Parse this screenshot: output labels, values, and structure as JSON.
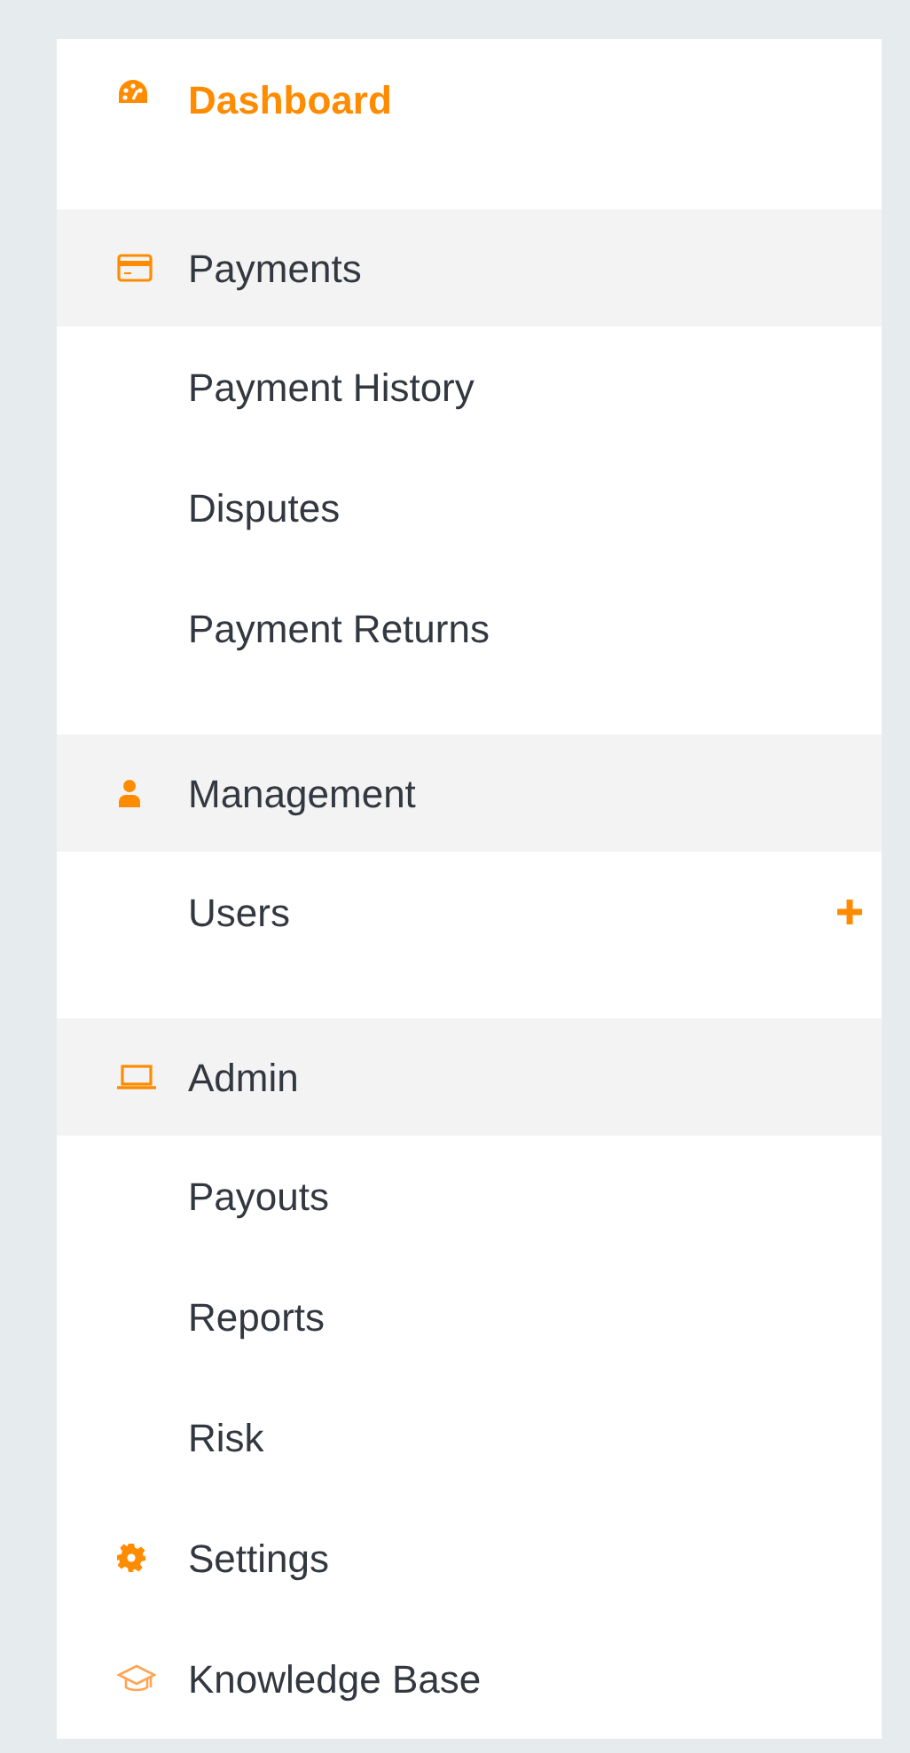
{
  "menu": [
    {
      "kind": "link",
      "label": "Dashboard",
      "selected": true
    },
    {
      "kind": "section",
      "label": "Payments",
      "selected": false,
      "children": [
        {
          "kind": "sub",
          "label": "Payment History",
          "selected": false
        },
        {
          "kind": "sub",
          "label": "Disputes",
          "selected": false
        },
        {
          "kind": "sub",
          "label": "Payment Returns",
          "selected": false
        }
      ]
    },
    {
      "kind": "section",
      "label": "Management",
      "selected": false,
      "children": [
        {
          "kind": "sub-add",
          "label": "Users",
          "selected": false
        }
      ]
    },
    {
      "kind": "section",
      "label": "Admin",
      "selected": false,
      "children": [
        {
          "kind": "sub",
          "label": "Payouts",
          "selected": false
        },
        {
          "kind": "sub",
          "label": "Reports",
          "selected": false
        },
        {
          "kind": "sub",
          "label": "Risk",
          "selected": false
        }
      ]
    },
    {
      "kind": "link",
      "label": "Settings",
      "selected": false
    },
    {
      "kind": "link",
      "label": "Knowledge Base",
      "selected": false
    }
  ]
}
